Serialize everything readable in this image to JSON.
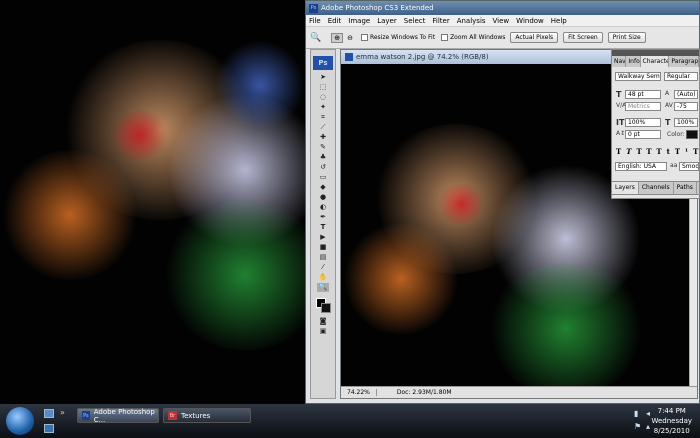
{
  "window": {
    "title": "Adobe Photoshop CS3 Extended"
  },
  "menu": [
    "File",
    "Edit",
    "Image",
    "Layer",
    "Select",
    "Filter",
    "Analysis",
    "View",
    "Window",
    "Help"
  ],
  "options": {
    "resize_label": "Resize Windows To Fit",
    "zoom_all_label": "Zoom All Windows",
    "actual_pixels": "Actual Pixels",
    "fit_screen": "Fit Screen",
    "print_size": "Print Size"
  },
  "toolbox": {
    "logo": "Ps"
  },
  "document": {
    "title": "emma watson 2.jpg @ 74.2% (RGB/8)",
    "zoom": "74.22%",
    "doc_size": "Doc: 2.93M/1.80M"
  },
  "character": {
    "tabs": [
      "Nav",
      "Info",
      "Character",
      "Paragraph"
    ],
    "font_family": "Walkway SemiBold",
    "font_style": "Regular",
    "font_size": "48 pt",
    "leading": "(Auto)",
    "kerning": "Metrics",
    "tracking": "-75",
    "vscale": "100%",
    "hscale": "100%",
    "baseline": "0 pt",
    "color_label": "Color:",
    "language": "English: USA",
    "antialias": "Smooth"
  },
  "layers_tabs": [
    "Layers",
    "Channels",
    "Paths"
  ],
  "taskbar": {
    "items": [
      "Adobe Photoshop C...",
      "Textures"
    ],
    "time": "7:44 PM",
    "day": "Wednesday",
    "date": "8/25/2010"
  }
}
